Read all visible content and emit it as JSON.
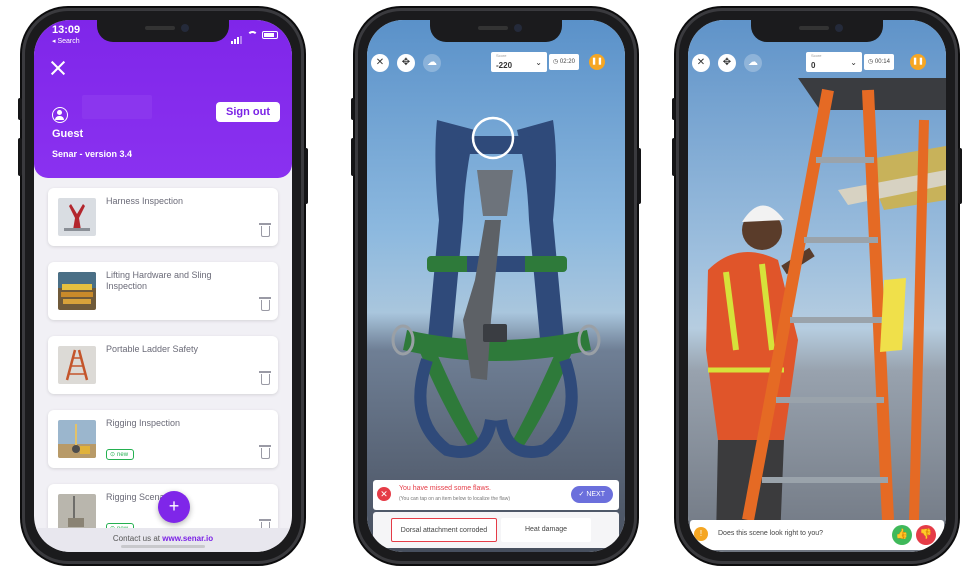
{
  "menu_screen": {
    "status": {
      "time": "13:09",
      "back": "◂ Search"
    },
    "user_name": "Guest",
    "sign_out_label": "Sign out",
    "version": "Senar - version 3.4",
    "courses": [
      {
        "title": "Harness Inspection",
        "badge": ""
      },
      {
        "title": "Lifting Hardware and Sling Inspection",
        "badge": ""
      },
      {
        "title": "Portable Ladder Safety",
        "badge": ""
      },
      {
        "title": "Rigging Inspection",
        "badge": "new"
      },
      {
        "title": "Rigging Scenarios",
        "badge": "new"
      }
    ],
    "add_label": "+",
    "footer_prefix": "Contact us at",
    "footer_link": "www.senar.io",
    "colors": {
      "brand": "#7f26e9",
      "badge_green": "#24b050"
    }
  },
  "harness_screen": {
    "score_label": "Score",
    "score": "-220",
    "timer": "02:20",
    "alert_title": "You have missed some flaws.",
    "alert_sub": "(You can tap on an item below to localize the flaw)",
    "next_label": "NEXT",
    "choices": [
      "Dorsal attachment corroded",
      "Heat damage"
    ]
  },
  "ladder_screen": {
    "score_label": "Score",
    "score": "0",
    "timer": "00:14",
    "question": "Does this scene look right to you?"
  },
  "icons": [
    "close-icon",
    "move-icon",
    "cloud-icon",
    "chevron-down-icon",
    "clock-icon",
    "pause-icon",
    "trash-icon",
    "user-icon",
    "plus-icon",
    "thumbs-up-icon",
    "thumbs-down-icon",
    "alert-icon"
  ]
}
